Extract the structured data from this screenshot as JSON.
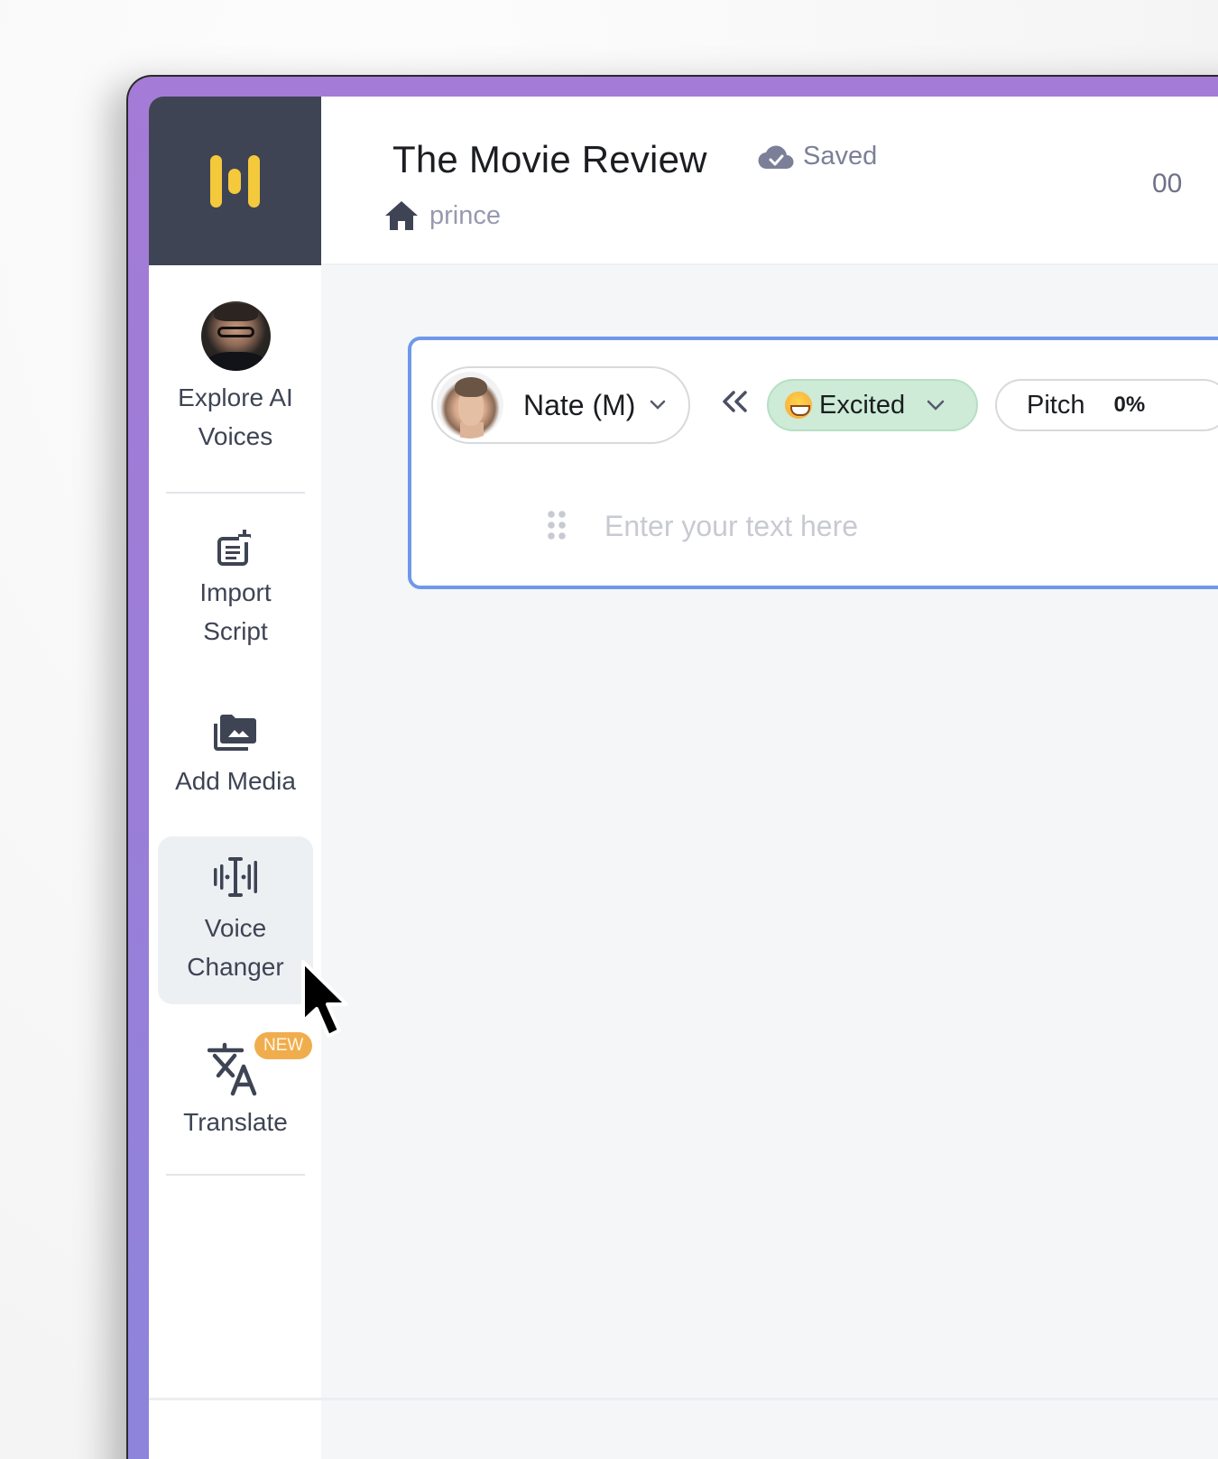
{
  "app": {
    "brand_color": "#f5c93c",
    "frame_gradient": [
      "#a47bd6",
      "#8c85dc"
    ],
    "accent_border": "#6f98ea"
  },
  "header": {
    "project_title": "The Movie Review",
    "save_status": "Saved",
    "breadcrumb": "prince",
    "time_readout": "00"
  },
  "sidebar": {
    "items": [
      {
        "label": "Explore AI Voices",
        "icon": "voice-avatar"
      },
      {
        "label": "Import Script",
        "icon": "import-script-icon"
      },
      {
        "label": "Add Media",
        "icon": "media-folder-icon"
      },
      {
        "label": "Voice Changer",
        "icon": "voice-wave-icon",
        "active": true
      },
      {
        "label": "Translate",
        "icon": "translate-icon",
        "badge": "NEW"
      }
    ]
  },
  "editor": {
    "voice": {
      "name": "Nate (M)"
    },
    "emotion": {
      "label": "Excited",
      "color": "#cdebd6"
    },
    "pitch": {
      "label": "Pitch",
      "value": "0%"
    },
    "text_input": {
      "value": "",
      "placeholder": "Enter your text here"
    }
  }
}
